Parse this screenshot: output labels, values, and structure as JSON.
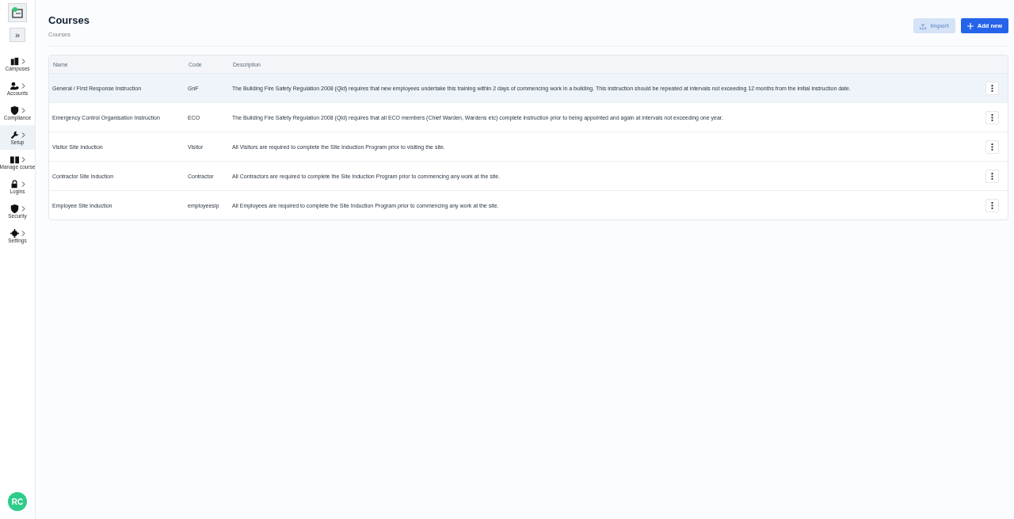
{
  "sidebar": {
    "expand_button": "»",
    "items": [
      {
        "label": "Campuses",
        "selected": false
      },
      {
        "label": "Accounts",
        "selected": false
      },
      {
        "label": "Compliance",
        "selected": false
      },
      {
        "label": "Setup",
        "selected": true
      },
      {
        "label": "Manage course",
        "selected": false
      },
      {
        "label": "Logins",
        "selected": false
      },
      {
        "label": "Security",
        "selected": false
      },
      {
        "label": "Settings",
        "selected": false
      }
    ],
    "avatar": "RC"
  },
  "header": {
    "title": "Courses",
    "breadcrumb": "Courses",
    "buttons": [
      {
        "label": "Import",
        "kind": "secondary"
      },
      {
        "label": "Add new",
        "kind": "primary"
      }
    ]
  },
  "table": {
    "columns": [
      "Name",
      "Code",
      "Description"
    ],
    "rows": [
      {
        "name": "General / First Response Instruction",
        "code": "GnF",
        "description": "The Building Fire Safety Regulation 2008 (Qld) requires that new employees undertake this training within 2 days of commencing work in a building. This instruction should be repeated at intervals not exceeding 12 months from the initial instruction date.",
        "selected": true
      },
      {
        "name": "Emergency Control Organisation Instruction",
        "code": "ECO",
        "description": "The Building Fire Safety Regulation 2008 (Qld) requires that all ECO members (Chief Warden, Wardens etc) complete instruction prior to being appointed and again at intervals not exceeding one year.",
        "selected": false
      },
      {
        "name": "Visitor Site Induction",
        "code": "Visitor",
        "description": "All Visitors are required to complete the Site Induction Program prior to visiting the site.",
        "selected": false
      },
      {
        "name": "Contractor Site Induction",
        "code": "Contractor",
        "description": "All Contractors are required to complete the Site Induction Program prior to commencing any work at the site.",
        "selected": false
      },
      {
        "name": "Employee Site Induction",
        "code": "employeesip",
        "description": "All Employees are required to complete the Site Induction Program prior to commencing any work at the site.",
        "selected": false
      }
    ]
  }
}
